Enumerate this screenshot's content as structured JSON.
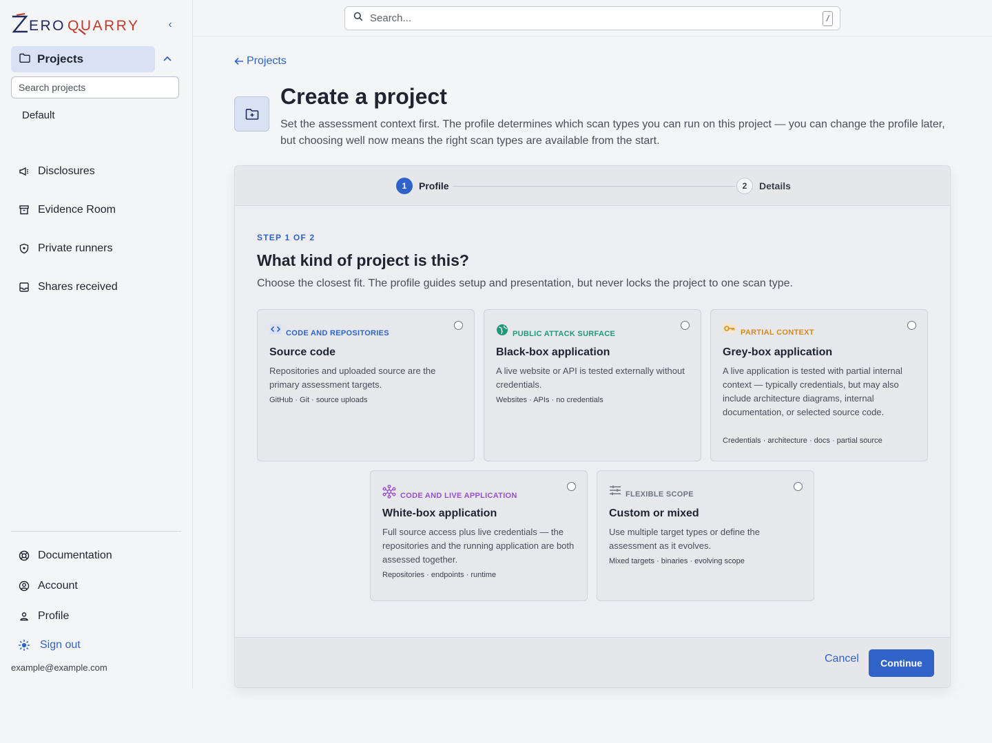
{
  "brand": {
    "logo_text": "ZeroQuarry"
  },
  "sidebar": {
    "projects_label": "Projects",
    "search_placeholder": "Search projects",
    "default_project": "Default",
    "nav": [
      {
        "label": "Disclosures",
        "icon": "megaphone-icon"
      },
      {
        "label": "Evidence Room",
        "icon": "archive-icon"
      },
      {
        "label": "Private runners",
        "icon": "shield-icon"
      },
      {
        "label": "Shares received",
        "icon": "inbox-icon"
      }
    ],
    "bottom": [
      {
        "label": "Documentation",
        "icon": "lifebuoy-icon"
      },
      {
        "label": "Account",
        "icon": "user-circle-icon"
      },
      {
        "label": "Profile",
        "icon": "user-icon"
      },
      {
        "label": "Sign out",
        "icon": "sun-icon"
      }
    ],
    "email": "example@example.com"
  },
  "topbar": {
    "search_placeholder": "Search...",
    "shortcut": "/"
  },
  "header": {
    "back_label": "Projects",
    "title": "Create a project",
    "description": "Set the assessment context first. The profile determines which scan types you can run on this project — you can change the profile later, but choosing well now means the right scan types are available from the start."
  },
  "stepper": {
    "steps": [
      {
        "num": "1",
        "label": "Profile",
        "active": true
      },
      {
        "num": "2",
        "label": "Details",
        "active": false
      }
    ]
  },
  "step": {
    "eyebrow": "STEP 1 OF 2",
    "title": "What kind of project is this?",
    "description": "Choose the closest fit. The profile guides setup and presentation, but never locks the project to one scan type."
  },
  "options": [
    {
      "category": "CODE AND REPOSITORIES",
      "color": "#2f63c8",
      "icon": "code-icon",
      "title": "Source code",
      "description": "Repositories and uploaded source are the primary assessment targets.",
      "tags": "GitHub · Git · source uploads"
    },
    {
      "category": "PUBLIC ATTACK SURFACE",
      "color": "#1e9a78",
      "icon": "globe-icon",
      "title": "Black-box application",
      "description": "A live website or API is tested externally without credentials.",
      "tags": "Websites · APIs · no credentials"
    },
    {
      "category": "PARTIAL CONTEXT",
      "color": "#d48a1e",
      "icon": "key-icon",
      "title": "Grey-box application",
      "description": "A live application is tested with partial internal context — typically credentials, but may also include architecture diagrams, internal documentation, or selected source code.",
      "tags": "Credentials · architecture · docs · partial source"
    },
    {
      "category": "CODE AND LIVE APPLICATION",
      "color": "#9a4fd0",
      "icon": "network-icon",
      "title": "White-box application",
      "description": "Full source access plus live credentials — the repositories and the running application are both assessed together.",
      "tags": "Repositories · endpoints · runtime"
    },
    {
      "category": "FLEXIBLE SCOPE",
      "color": "#6b7480",
      "icon": "sliders-icon",
      "title": "Custom or mixed",
      "description": "Use multiple target types or define the assessment as it evolves.",
      "tags": "Mixed targets · binaries · evolving scope"
    }
  ],
  "footer": {
    "cancel_label": "Cancel",
    "continue_label": "Continue"
  }
}
